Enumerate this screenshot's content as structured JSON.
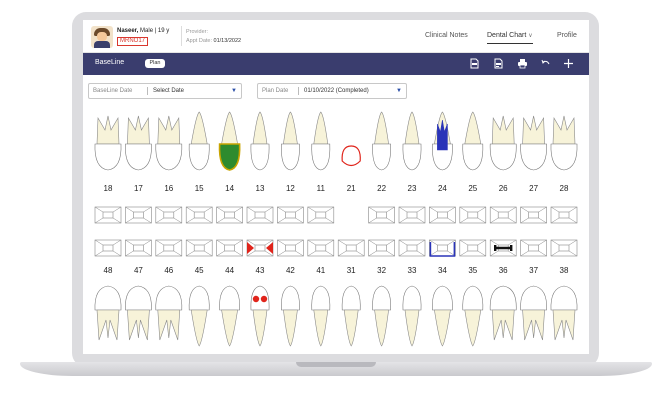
{
  "header": {
    "patient_name": "Naseer,",
    "patient_info": "Male | 19 y",
    "mrn": "MRNO17",
    "provider_label": "Provider:",
    "appt_label": "Appt Date:",
    "appt_date": "01/13/2022",
    "nav": [
      {
        "label": "Clinical Notes",
        "active": false
      },
      {
        "label": "Dental Chart",
        "active": true
      },
      {
        "label": "Profile",
        "active": false
      }
    ],
    "dropdown_icon": "chevron-down-icon"
  },
  "toolbar": {
    "title": "BaseLine",
    "plan_label": "Plan",
    "icons": [
      "pdf-icon",
      "pdf-export-icon",
      "print-icon",
      "undo-icon",
      "add-icon"
    ],
    "bg_color": "#3a3d6e"
  },
  "filters": {
    "baseline_date_label": "BaseLine Date",
    "baseline_date_value": "Select Date",
    "plan_date_label": "Plan Date",
    "plan_date_value": "01/10/2022 (Completed)"
  },
  "upper_teeth": [
    "18",
    "17",
    "16",
    "15",
    "14",
    "13",
    "12",
    "11",
    "21",
    "22",
    "23",
    "24",
    "25",
    "26",
    "27",
    "28"
  ],
  "lower_teeth": [
    "48",
    "47",
    "46",
    "45",
    "44",
    "43",
    "42",
    "41",
    "31",
    "32",
    "33",
    "34",
    "35",
    "36",
    "37",
    "38"
  ],
  "annotations": {
    "tooth_14": "green crown fill",
    "tooth_21": "missing - red outline",
    "tooth_24": "blue root canal",
    "tooth_43": "red restorations",
    "tooth_34": "blue surface bracket",
    "tooth_36": "black bridge marker"
  },
  "colors": {
    "green_fill": "#2e8b2e",
    "red_mark": "#e0241b",
    "blue_mark": "#2a34b8",
    "tooth_fill": "#f7f3d9"
  }
}
